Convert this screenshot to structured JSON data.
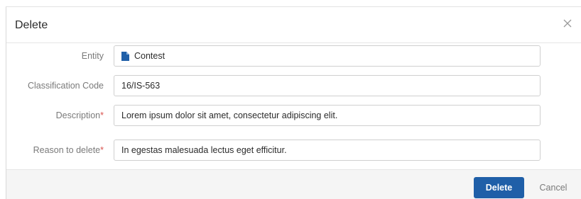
{
  "dialog": {
    "title": "Delete",
    "close_icon": "close-icon"
  },
  "form": {
    "entity": {
      "label": "Entity",
      "value": "Contest",
      "icon": "document-icon"
    },
    "classification_code": {
      "label": "Classification Code",
      "value": "16/IS-563"
    },
    "description": {
      "label": "Description",
      "required_mark": "*",
      "value": "Lorem ipsum dolor sit amet, consectetur adipiscing elit."
    },
    "reason": {
      "label": "Reason to delete",
      "required_mark": "*",
      "value": "In egestas malesuada lectus eget efficitur."
    }
  },
  "footer": {
    "delete_label": "Delete",
    "cancel_label": "Cancel"
  },
  "colors": {
    "primary": "#1f5fa8",
    "required": "#d9534f",
    "footer_bg": "#f5f5f5"
  }
}
